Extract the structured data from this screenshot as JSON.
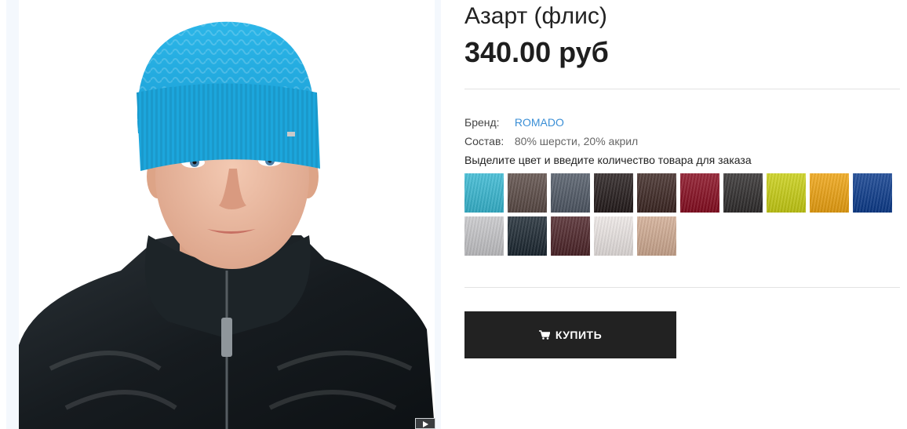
{
  "product": {
    "title": "Азарт (флис)",
    "price": "340.00 руб"
  },
  "attributes": {
    "brand_label": "Бренд:",
    "brand_value": "ROMADO",
    "composition_label": "Состав:",
    "composition_value": "80% шерсти, 20% акрил"
  },
  "color_hint": "Выделите цвет и введите количество товара для заказа",
  "swatches": [
    {
      "name": "turquoise",
      "color": "#36b8d2"
    },
    {
      "name": "brown-grey",
      "color": "#5a4a45"
    },
    {
      "name": "slate",
      "color": "#4f5865"
    },
    {
      "name": "black-brown",
      "color": "#231a1a"
    },
    {
      "name": "dark-brown",
      "color": "#3c2622"
    },
    {
      "name": "burgundy",
      "color": "#880b1f"
    },
    {
      "name": "graphite",
      "color": "#2e2b2b"
    },
    {
      "name": "lime",
      "color": "#c9cf12"
    },
    {
      "name": "orange",
      "color": "#efa30f"
    },
    {
      "name": "royal-blue",
      "color": "#0a3a8c"
    },
    {
      "name": "light-grey",
      "color": "#c6c6c9"
    },
    {
      "name": "navy-black",
      "color": "#1a2630"
    },
    {
      "name": "maroon-brown",
      "color": "#4c2327"
    },
    {
      "name": "cream",
      "color": "#ece6e4"
    },
    {
      "name": "beige",
      "color": "#d1ab92"
    }
  ],
  "buy_button": {
    "label": "КУПИТЬ",
    "icon": "cart-icon"
  },
  "gallery": {
    "zoom_icon": "play-arrow-icon"
  }
}
